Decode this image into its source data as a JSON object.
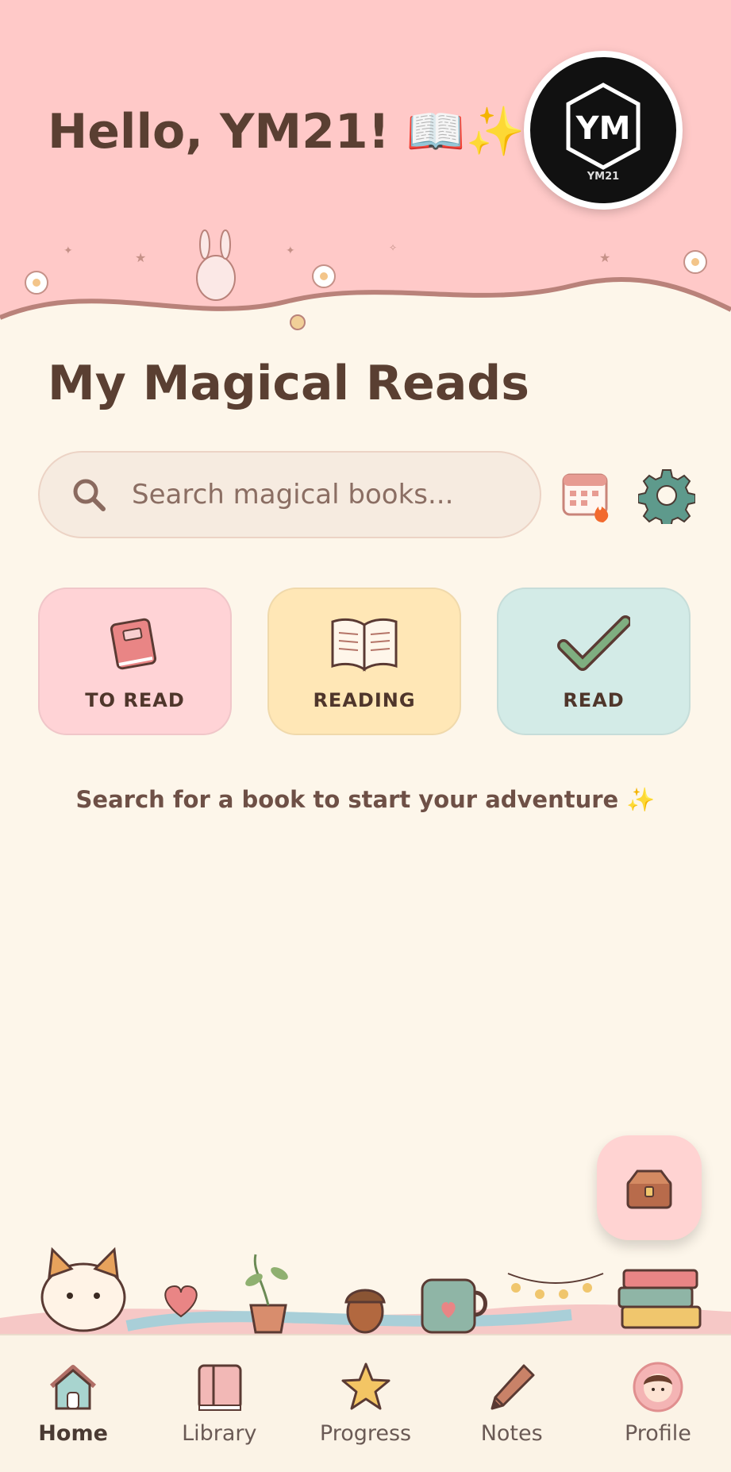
{
  "header": {
    "greeting": "Hello, YM21! 📖✨",
    "logo_text": "YM",
    "logo_subtext": "YM21"
  },
  "page_title": "My Magical Reads",
  "search": {
    "placeholder": "Search magical books..."
  },
  "tools": {
    "calendar_icon": "calendar-fire-icon",
    "settings_icon": "gear-icon"
  },
  "categories": [
    {
      "label": "TO READ",
      "icon": "book-icon",
      "color": "#ffd3d6"
    },
    {
      "label": "READING",
      "icon": "open-book-icon",
      "color": "#ffe7b6"
    },
    {
      "label": "READ",
      "icon": "checkmark-icon",
      "color": "#d3ebe7"
    }
  ],
  "hint": "Search for a book to start your adventure ✨",
  "fab_icon": "treasure-chest-icon",
  "nav": [
    {
      "label": "Home",
      "icon": "house-icon",
      "active": true
    },
    {
      "label": "Library",
      "icon": "books-icon",
      "active": false
    },
    {
      "label": "Progress",
      "icon": "star-icon",
      "active": false
    },
    {
      "label": "Notes",
      "icon": "pencil-icon",
      "active": false
    },
    {
      "label": "Profile",
      "icon": "profile-avatar-icon",
      "active": false
    }
  ],
  "colors": {
    "header_bg": "#ffc9c8",
    "page_bg": "#fdf6ea",
    "text": "#5a3f32"
  }
}
